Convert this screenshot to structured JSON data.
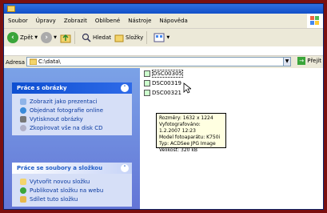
{
  "menu": [
    "Soubor",
    "Úpravy",
    "Zobrazit",
    "Oblíbené",
    "Nástroje",
    "Nápověda"
  ],
  "toolbar": {
    "back_label": "Zpět",
    "search_label": "Hledat",
    "folders_label": "Složky"
  },
  "address": {
    "label": "Adresa",
    "value": "C:\\data\\",
    "go_label": "Přejít"
  },
  "panel_images": {
    "title": "Práce s obrázky",
    "tasks": [
      {
        "label": "Zobrazit jako prezentaci",
        "icon": "slideshow-icon",
        "color": "#8fb4e8"
      },
      {
        "label": "Objednat fotografie online",
        "icon": "order-prints-icon",
        "color": "#3a8ad8"
      },
      {
        "label": "Vytisknout obrázky",
        "icon": "printer-icon",
        "color": "#777777"
      },
      {
        "label": "Zkopírovat vše na disk CD",
        "icon": "cd-icon",
        "color": "#b0b0c8"
      }
    ]
  },
  "panel_files": {
    "title": "Práce se soubory a složkou",
    "tasks": [
      {
        "label": "Vytvořit novou složku",
        "icon": "new-folder-icon",
        "color": "#f3d46b"
      },
      {
        "label": "Publikovat složku na webu",
        "icon": "publish-web-icon",
        "color": "#3aa53a"
      },
      {
        "label": "Sdílet tuto složku",
        "icon": "share-folder-icon",
        "color": "#e8b84b"
      }
    ]
  },
  "files": [
    "DSC00305",
    "DSC00319",
    "DSC00321"
  ],
  "tooltip": [
    "Rozměry: 1632 x 1224",
    "Vyfotografováno: 1.2.2007 12:23",
    "Model fotoaparátu: K750i",
    "Typ: ACDSee JPG Image",
    "Velikost: 320 kB"
  ]
}
